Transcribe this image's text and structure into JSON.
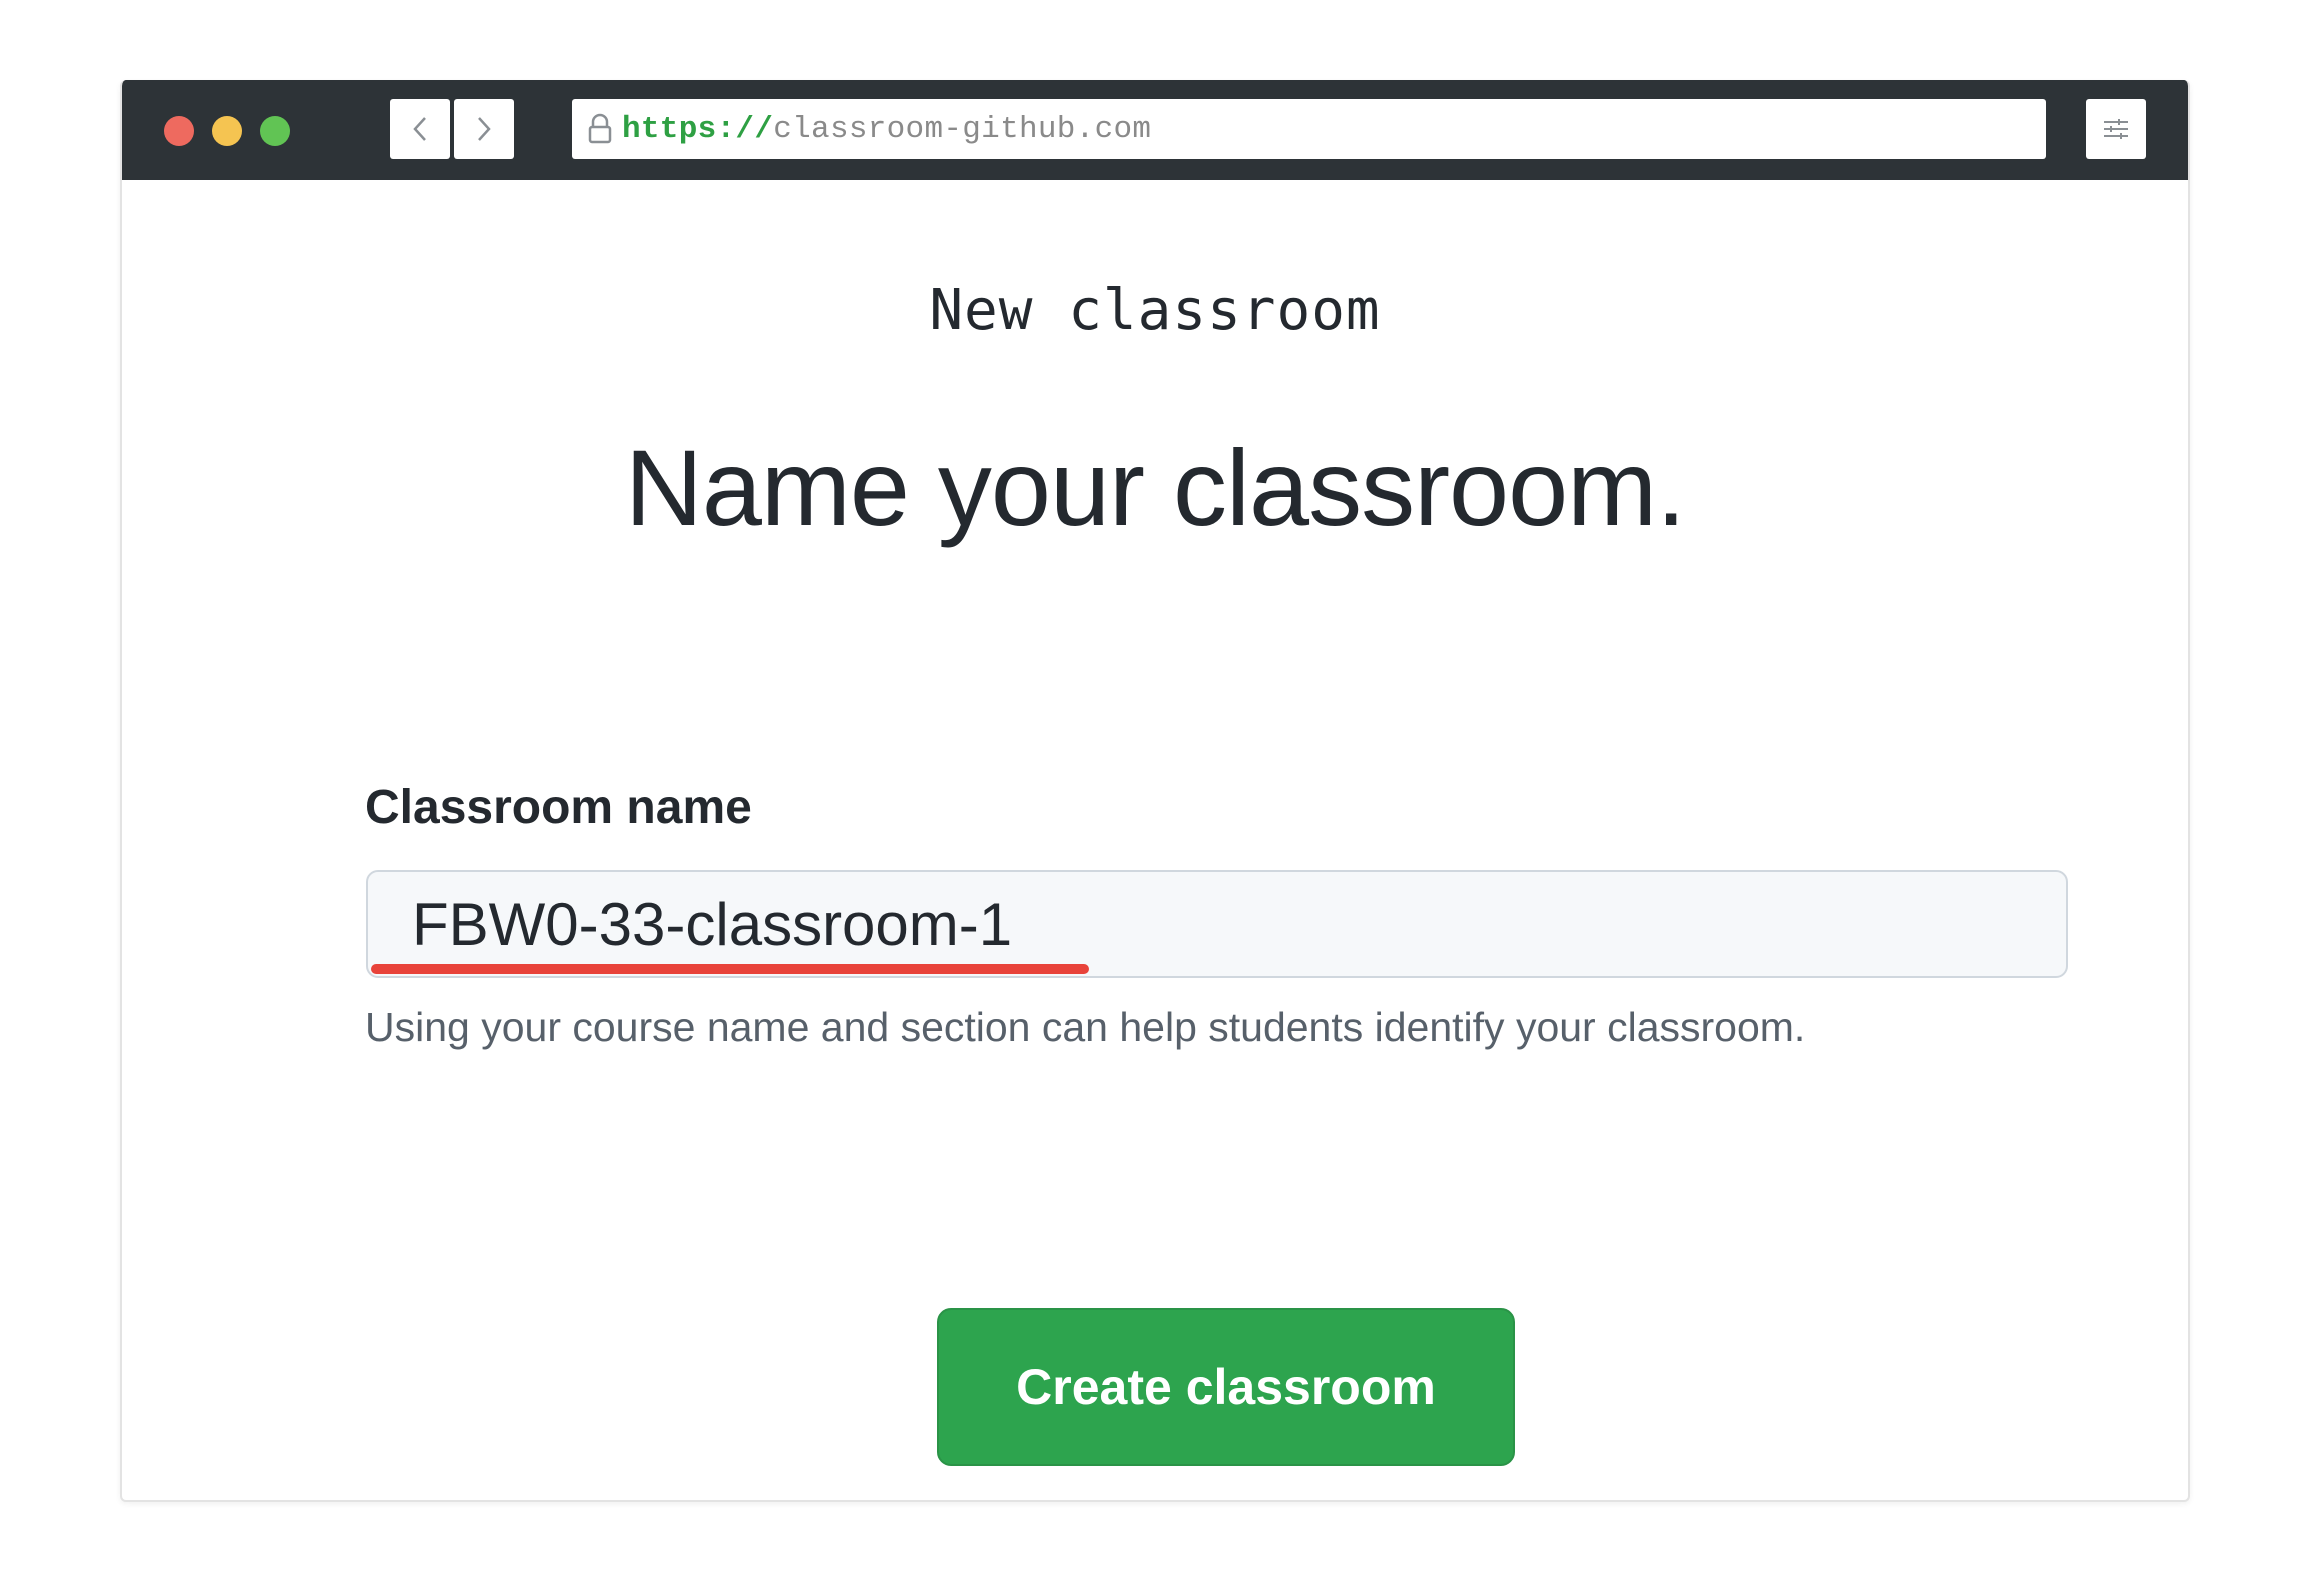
{
  "browser": {
    "url_scheme": "https://",
    "url_host": "classroom-github.com",
    "colors": {
      "close_dot": "#ee6a5f",
      "minimize_dot": "#f5c451",
      "maximize_dot": "#61c454",
      "toolbar": "#2d3337"
    },
    "icons": {
      "back": "chevron-left-icon",
      "forward": "chevron-right-icon",
      "lock": "lock-icon",
      "menu": "sliders-icon"
    }
  },
  "page": {
    "subtitle": "New classroom",
    "title": "Name your classroom.",
    "form": {
      "label": "Classroom name",
      "input_value": "FBW0-33-classroom-1",
      "hint": "Using your course name and section can help students identify your classroom."
    },
    "submit_label": "Create classroom",
    "colors": {
      "submit": "#2da44e",
      "highlight_underline": "#e8433a"
    }
  }
}
